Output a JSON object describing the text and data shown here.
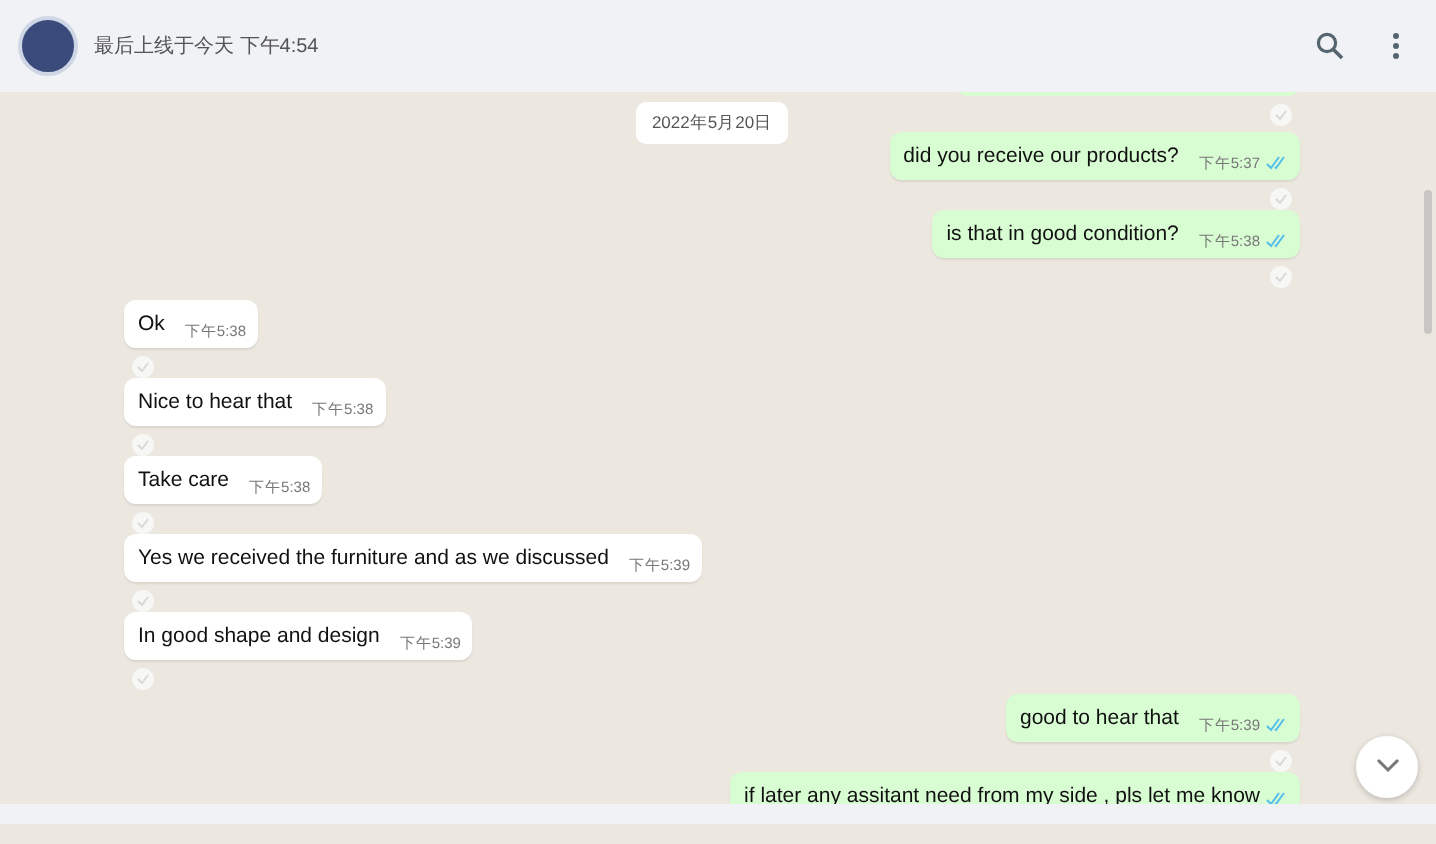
{
  "header": {
    "status": "最后上线于今天 下午4:54"
  },
  "date_chip": "2022年5月20日",
  "messages": [
    {
      "kind": "sent",
      "text": "did you receive our products?",
      "time": "下午5:37",
      "read": true
    },
    {
      "kind": "sent",
      "text": "is that in good condition?",
      "time": "下午5:38",
      "read": true
    },
    {
      "kind": "received",
      "text": "Ok",
      "time": "下午5:38"
    },
    {
      "kind": "received",
      "text": "Nice to hear that",
      "time": "下午5:38"
    },
    {
      "kind": "received",
      "text": "Take care",
      "time": "下午5:38"
    },
    {
      "kind": "received",
      "text": "Yes we received the furniture and as we discussed",
      "time": "下午5:39"
    },
    {
      "kind": "received",
      "text": "In good shape and design",
      "time": "下午5:39"
    },
    {
      "kind": "sent",
      "text": "good to hear that",
      "time": "下午5:39",
      "read": true
    },
    {
      "kind": "sent",
      "text": "if later any assitant need from my side , pls let me know",
      "read": true
    }
  ]
}
